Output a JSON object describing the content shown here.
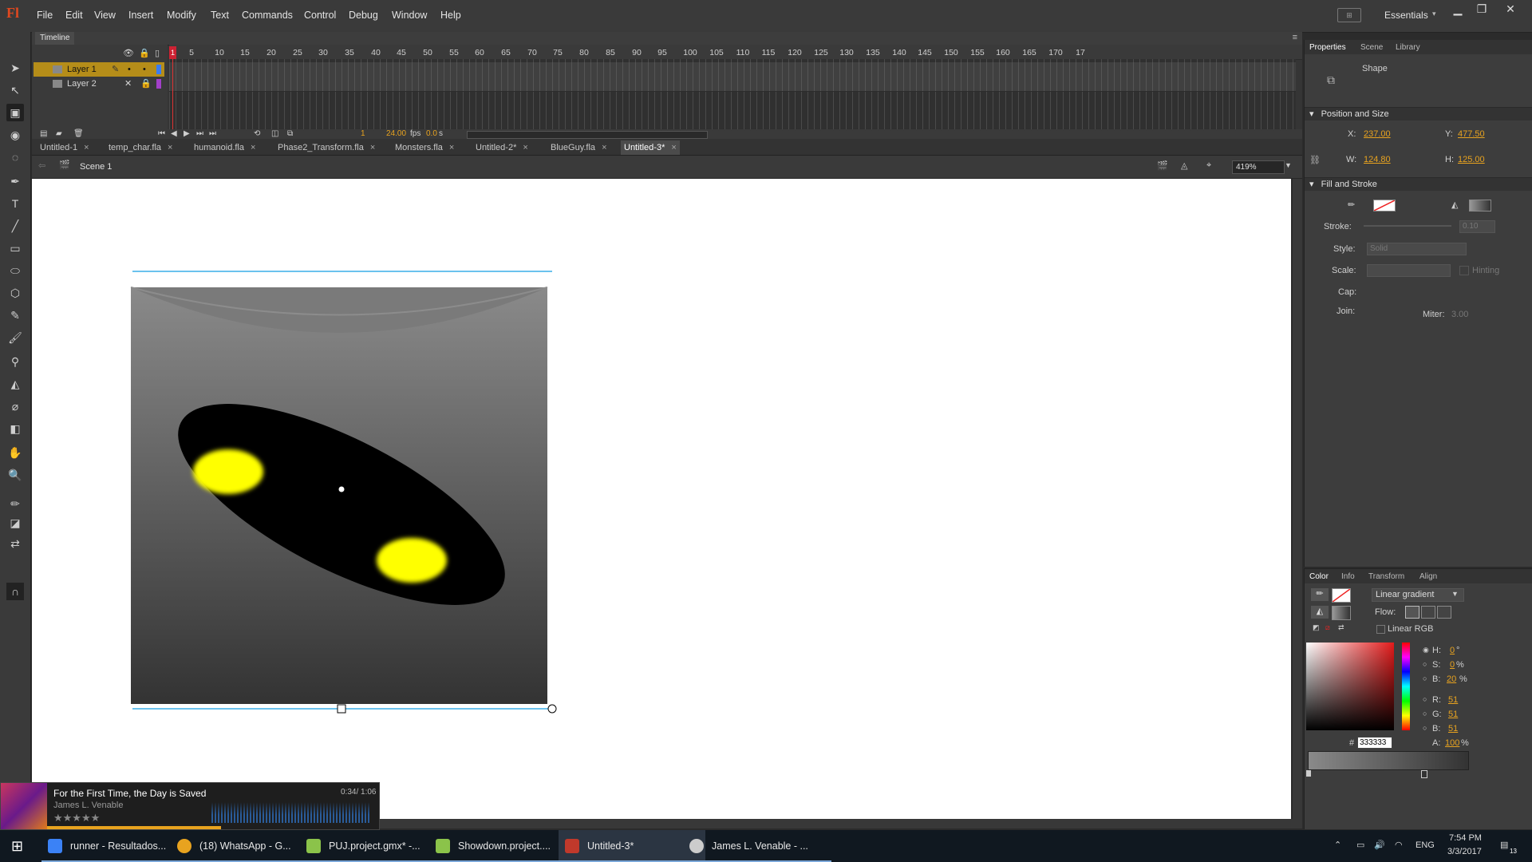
{
  "app": {
    "logo": "Fl"
  },
  "menu": [
    "File",
    "Edit",
    "View",
    "Insert",
    "Modify",
    "Text",
    "Commands",
    "Control",
    "Debug",
    "Window",
    "Help"
  ],
  "workspace": {
    "label": "Essentials",
    "switch_glyph": "⊞"
  },
  "timeline": {
    "tab": "Timeline",
    "layers": [
      {
        "name": "Layer 1",
        "selected": true
      },
      {
        "name": "Layer 2",
        "selected": false
      }
    ],
    "frame_numbers": [
      "1",
      "5",
      "10",
      "15",
      "20",
      "25",
      "30",
      "35",
      "40",
      "45",
      "50",
      "55",
      "60",
      "65",
      "70",
      "75",
      "80",
      "85",
      "90",
      "95",
      "100",
      "105",
      "110",
      "115",
      "120",
      "125",
      "130",
      "135",
      "140",
      "145",
      "150",
      "155",
      "160",
      "165",
      "170",
      "17"
    ],
    "current_frame": "1",
    "fps": "24.00",
    "fps_unit": "fps",
    "time": "0.0",
    "time_unit": "s"
  },
  "doc_tabs": [
    {
      "label": "Untitled-1",
      "active": false
    },
    {
      "label": "temp_char.fla",
      "active": false
    },
    {
      "label": "humanoid.fla",
      "active": false
    },
    {
      "label": "Phase2_Transform.fla",
      "active": false
    },
    {
      "label": "Monsters.fla",
      "active": false
    },
    {
      "label": "Untitled-2*",
      "active": false
    },
    {
      "label": "BlueGuy.fla",
      "active": false
    },
    {
      "label": "Untitled-3*",
      "active": true
    }
  ],
  "editbar": {
    "scene": "Scene 1",
    "zoom": "419%"
  },
  "properties": {
    "tabs": [
      "Properties",
      "Scene",
      "Library"
    ],
    "object_type": "Shape",
    "position_size": {
      "header": "Position and Size",
      "x_label": "X:",
      "x": "237.00",
      "y_label": "Y:",
      "y": "477.50",
      "w_label": "W:",
      "w": "124.80",
      "h_label": "H:",
      "h": "125.00"
    },
    "fill_stroke": {
      "header": "Fill and Stroke",
      "stroke_label": "Stroke:",
      "stroke_value": "0.10",
      "style_label": "Style:",
      "style_value": "Solid",
      "scale_label": "Scale:",
      "hinting_label": "Hinting",
      "cap_label": "Cap:",
      "join_label": "Join:",
      "miter_label": "Miter:",
      "miter_value": "3.00"
    }
  },
  "color_panel": {
    "tabs": [
      "Color",
      "Info",
      "Transform",
      "Align"
    ],
    "fill_type": "Linear gradient",
    "flow_label": "Flow:",
    "linear_rgb_label": "Linear RGB",
    "h_label": "H:",
    "h": "0",
    "h_unit": "°",
    "s_label": "S:",
    "s": "0",
    "s_unit": "%",
    "b_label": "B:",
    "b": "20",
    "b_unit": "%",
    "r_label": "R:",
    "r": "51",
    "g_label": "G:",
    "g": "51",
    "bl_label": "B:",
    "bl": "51",
    "hex_prefix": "#",
    "hex": "333333",
    "a_label": "A:",
    "a": "100",
    "a_unit": "%"
  },
  "music": {
    "title": "For the First Time, the Day is Saved",
    "artist": "James L. Venable",
    "time": "0:34/ 1:06",
    "rating_stars": "★★★★★",
    "progress": 0.52
  },
  "taskbar": {
    "items": [
      {
        "label": "runner - Resultados...",
        "color": "#3b82f6"
      },
      {
        "label": "(18) WhatsApp - G...",
        "color": "#e8a31f"
      },
      {
        "label": "PUJ.project.gmx* -...",
        "color": "#8bc34a"
      },
      {
        "label": "Showdown.project....",
        "color": "#8bc34a"
      },
      {
        "label": "Untitled-3*",
        "color": "#c0392b"
      },
      {
        "label": "James L. Venable - ...",
        "color": "#cccccc"
      }
    ],
    "tray": {
      "lang": "ENG",
      "time": "7:54 PM",
      "date": "3/3/2017",
      "notif": "13"
    }
  },
  "colors": {
    "accent": "#e8a31f",
    "layer_selected": "#b58d19",
    "playhead": "#cc2233",
    "eye_fill": "#ffff00"
  }
}
